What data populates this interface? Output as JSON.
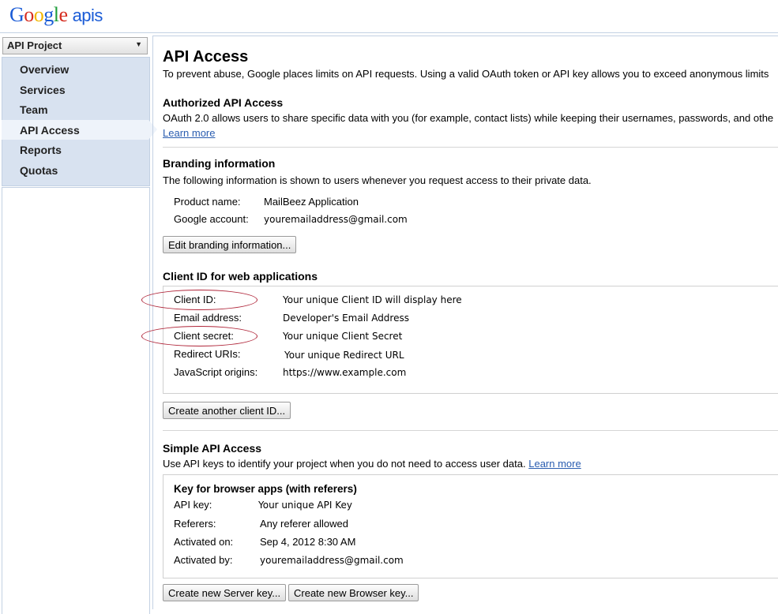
{
  "header": {
    "logo_letters": [
      "G",
      "o",
      "o",
      "g",
      "l",
      "e"
    ],
    "logo_suffix": "apis"
  },
  "sidebar": {
    "project": "API Project",
    "items": [
      {
        "label": "Overview"
      },
      {
        "label": "Services"
      },
      {
        "label": "Team"
      },
      {
        "label": "API Access",
        "active": true
      },
      {
        "label": "Reports"
      },
      {
        "label": "Quotas"
      }
    ]
  },
  "main": {
    "title": "API Access",
    "intro": "To prevent abuse, Google places limits on API requests. Using a valid OAuth token or API key allows you to exceed anonymous limits",
    "authorized": {
      "heading": "Authorized API Access",
      "text": "OAuth 2.0 allows users to share specific data with you (for example, contact lists) while keeping their usernames, passwords, and othe",
      "learn_more": "Learn more"
    },
    "branding": {
      "heading": "Branding information",
      "text": "The following information is shown to users whenever you request access to their private data.",
      "product_label": "Product name:",
      "product_value": "MailBeez Application",
      "account_label": "Google account:",
      "account_value": "youremailaddress@gmail.com",
      "edit_button": "Edit branding information..."
    },
    "client_id": {
      "heading": "Client ID for web applications",
      "rows": [
        {
          "label": "Client ID:",
          "value": "Your unique Client ID will display here"
        },
        {
          "label": "Email address:",
          "value": "Developer's Email Address"
        },
        {
          "label": "Client secret:",
          "value": "Your unique Client Secret"
        },
        {
          "label": "Redirect URIs:",
          "value": "Your unique Redirect URL"
        },
        {
          "label": "JavaScript origins:",
          "value": "https://www.example.com"
        }
      ],
      "create_button": "Create another client ID..."
    },
    "simple": {
      "heading": "Simple API Access",
      "text": "Use API keys to identify your project when you do not need to access user data.",
      "learn_more": "Learn more",
      "box_heading": "Key for browser apps (with referers)",
      "rows": [
        {
          "label": "API key:",
          "value": "Your unique API Key"
        },
        {
          "label": "Referers:",
          "value": "Any referer allowed"
        },
        {
          "label": "Activated on:",
          "value": "Sep 4, 2012 8:30 AM"
        },
        {
          "label": "Activated by:",
          "value": "youremailaddress@gmail.com"
        }
      ],
      "server_button": "Create new Server key...",
      "browser_button": "Create new Browser key..."
    }
  }
}
